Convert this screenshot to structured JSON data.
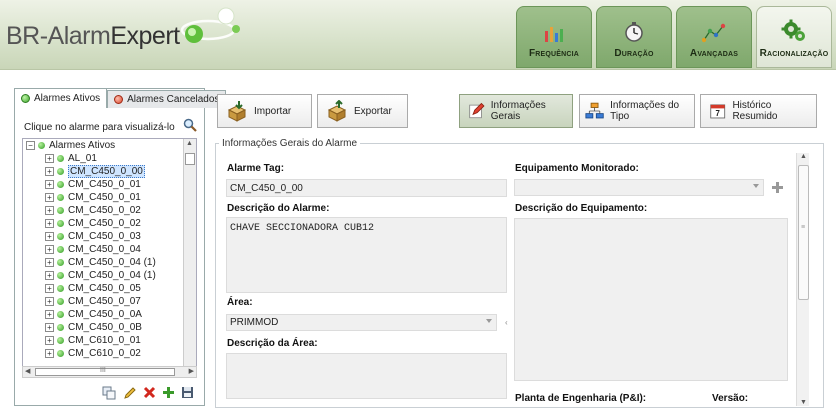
{
  "app": {
    "logo_part1": "BR-Alarm",
    "logo_part2": "Expert"
  },
  "tabs": [
    {
      "label": "Frequência",
      "icon": "bar-chart-icon",
      "active": false
    },
    {
      "label": "Duração",
      "icon": "clock-icon",
      "active": false
    },
    {
      "label": "Avançadas",
      "icon": "network-chart-icon",
      "active": false
    },
    {
      "label": "Racionalização",
      "icon": "gears-icon",
      "active": true
    }
  ],
  "left_panel": {
    "tab_active": "Alarmes Ativos",
    "tab_cancelled": "Alarmes Cancelados",
    "hint": "Clique no alarme para visualizá-lo",
    "tree_root": "Alarmes Ativos",
    "tree_items": [
      "AL_01",
      "CM_C450_0_00",
      "CM_C450_0_01",
      "CM_C450_0_01",
      "CM_C450_0_02",
      "CM_C450_0_02",
      "CM_C450_0_03",
      "CM_C450_0_04",
      "CM_C450_0_04 (1)",
      "CM_C450_0_04 (1)",
      "CM_C450_0_05",
      "CM_C450_0_07",
      "CM_C450_0_0A",
      "CM_C450_0_0B",
      "CM_C610_0_01",
      "CM_C610_0_02"
    ],
    "selected_index": 1,
    "scroll_label": "III"
  },
  "toolbar": {
    "import_label": "Importar",
    "export_label": "Exportar",
    "general_info_label": "Informações Gerais",
    "type_info_label": "Informações do Tipo",
    "history_label": "Histórico Resumido"
  },
  "form": {
    "group_title": "Informações Gerais do Alarme",
    "alarm_tag_label": "Alarme Tag:",
    "alarm_tag_value": "CM_C450_0_00",
    "alarm_desc_label": "Descrição do Alarme:",
    "alarm_desc_value": "CHAVE SECCIONADORA CUB12",
    "area_label": "Área:",
    "area_value": "PRIMMOD",
    "area_desc_label": "Descrição da Área:",
    "area_desc_value": "",
    "equipment_label": "Equipamento Monitorado:",
    "equipment_value": "",
    "equipment_desc_label": "Descrição do Equipamento:",
    "equipment_desc_value": "",
    "plant_label": "Planta de Engenharia (P&I):",
    "version_label": "Versão:"
  }
}
